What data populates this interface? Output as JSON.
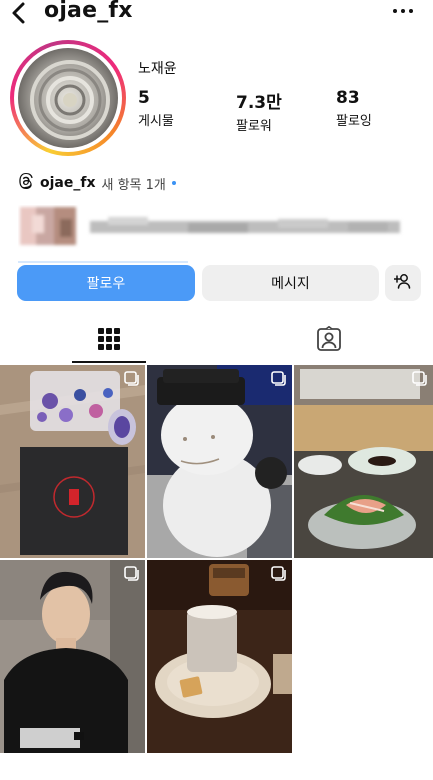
{
  "profile": {
    "username": "ojae_fx",
    "display_name": "노재윤",
    "stats": [
      {
        "value": "5",
        "label": "게시물"
      },
      {
        "value": "7.3만",
        "label": "팔로워"
      },
      {
        "value": "83",
        "label": "팔로잉"
      }
    ]
  },
  "threads": {
    "handle": "ojae_fx",
    "new_items": "새 항목 1개"
  },
  "actions": {
    "follow": "팔로우",
    "message": "메시지"
  },
  "icons": {
    "back": "back-chevron-icon",
    "more": "more-dots-icon",
    "threads": "threads-logo-icon",
    "suggest": "add-person-icon",
    "grid_tab": "grid-icon",
    "tagged_tab": "tagged-person-icon",
    "multi": "multiple-posts-icon"
  },
  "colors": {
    "primary_button": "#4b9af7",
    "secondary_button": "#efefef",
    "unread_dot": "#3b92f4"
  },
  "posts": [
    {
      "id": "post-1",
      "subject": "netflix-box-and-stickers"
    },
    {
      "id": "post-2",
      "subject": "snowman"
    },
    {
      "id": "post-3",
      "subject": "sashimi-dish"
    },
    {
      "id": "post-4",
      "subject": "portrait-black-tshirt"
    },
    {
      "id": "post-5",
      "subject": "drink-on-plate"
    }
  ]
}
